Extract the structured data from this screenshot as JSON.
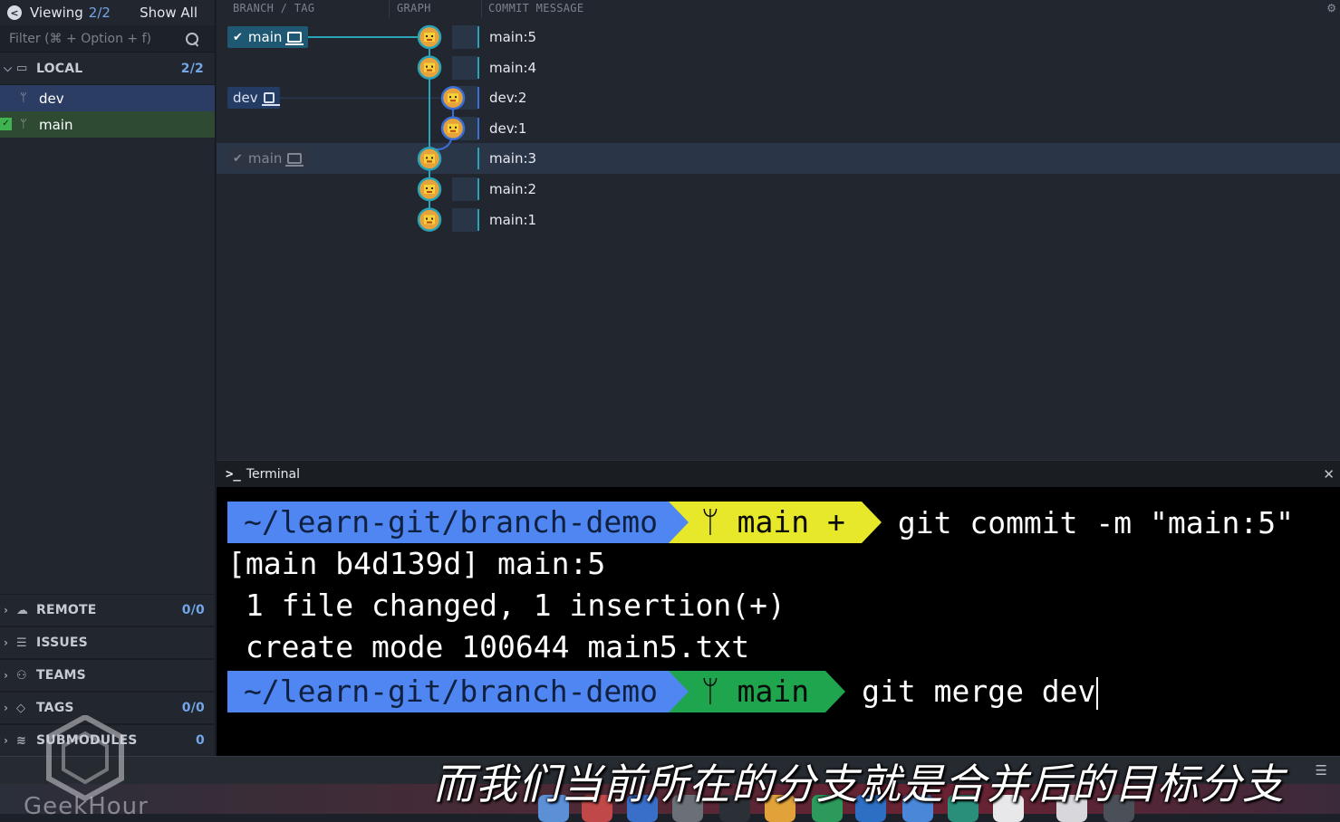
{
  "sidebar": {
    "viewing_label": "Viewing",
    "viewing_count": "2/2",
    "show_all": "Show All",
    "filter_placeholder": "Filter (⌘ + Option + f)",
    "local": {
      "label": "LOCAL",
      "count": "2/2"
    },
    "local_branches": [
      {
        "name": "dev"
      },
      {
        "name": "main"
      }
    ],
    "sections": [
      {
        "label": "REMOTE",
        "count": "0/0",
        "icon": "cloud-icon"
      },
      {
        "label": "ISSUES",
        "count": "",
        "icon": "list-icon"
      },
      {
        "label": "TEAMS",
        "count": "",
        "icon": "people-icon"
      },
      {
        "label": "TAGS",
        "count": "0/0",
        "icon": "tag-icon"
      },
      {
        "label": "SUBMODULES",
        "count": "0",
        "icon": "stack-icon"
      }
    ]
  },
  "graph": {
    "headers": {
      "branch_tag": "BRANCH / TAG",
      "graph": "GRAPH",
      "commit_message": "COMMIT MESSAGE"
    },
    "tags": {
      "main_active": "main",
      "dev": "dev",
      "main_faded": "main"
    },
    "commits": [
      {
        "message": "main:5",
        "lane": "main",
        "selected": false
      },
      {
        "message": "main:4",
        "lane": "main",
        "selected": false
      },
      {
        "message": "dev:2",
        "lane": "dev",
        "selected": false
      },
      {
        "message": "dev:1",
        "lane": "dev",
        "selected": false
      },
      {
        "message": "main:3",
        "lane": "main",
        "selected": true
      },
      {
        "message": "main:2",
        "lane": "main",
        "selected": false
      },
      {
        "message": "main:1",
        "lane": "main",
        "selected": false
      }
    ],
    "colors": {
      "main": "#2aa3b8",
      "dev": "#3b6fd8"
    }
  },
  "terminal": {
    "title": "Terminal",
    "prompt1": {
      "path": "~/learn-git/branch-demo",
      "branch": "main +",
      "command": "git commit -m \"main:5\""
    },
    "output": [
      "[main b4d139d] main:5",
      " 1 file changed, 1 insertion(+)",
      " create mode 100644 main5.txt"
    ],
    "prompt2": {
      "path": "~/learn-git/branch-demo",
      "branch": "main",
      "command": "git merge dev"
    },
    "colors": {
      "path_bg": "#4f86f2",
      "branch_dirty_bg": "#e8e82a",
      "branch_clean_bg": "#1fa54d"
    }
  },
  "overlay": {
    "subtitle": "而我们当前所在的分支就是合并后的目标分支",
    "watermark": "GeekHour"
  }
}
